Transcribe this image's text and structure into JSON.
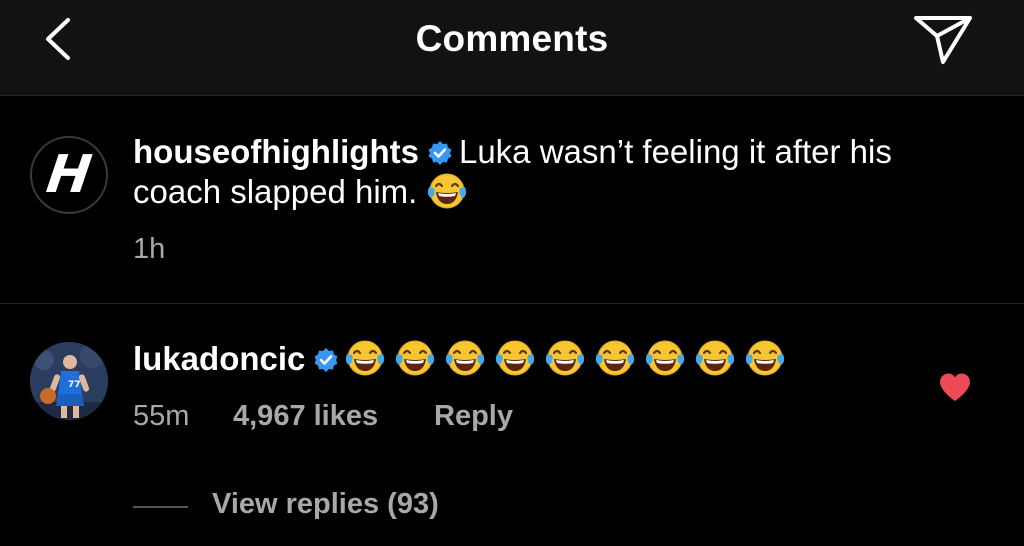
{
  "header": {
    "title": "Comments",
    "back_icon": "chevron-left-icon",
    "send_icon": "paper-plane-icon"
  },
  "caption": {
    "username": "houseofhighlights",
    "text_line1": "Luka wasn’t feeling it after his",
    "text_line2": "coach slapped him.",
    "time": "1h",
    "avatar_letter": "H"
  },
  "comment": {
    "username": "lukadoncic",
    "emoji_count": 9,
    "time": "55m",
    "likes": "4,967 likes",
    "reply_label": "Reply",
    "view_replies": "View replies (93)"
  },
  "colors": {
    "background": "#000000",
    "header_bg": "#121212",
    "secondary_text": "#a8a8a8",
    "verified_blue": "#3897f0",
    "heart_red": "#ed4956"
  }
}
